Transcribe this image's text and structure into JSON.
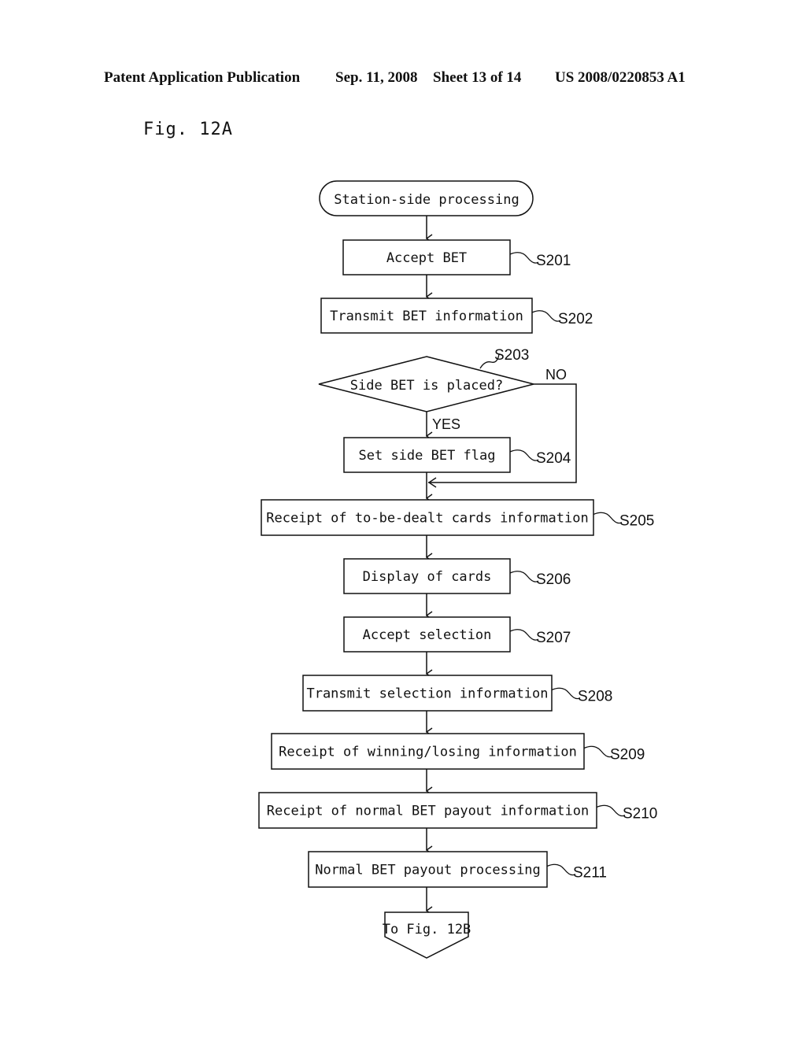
{
  "header": {
    "publication": "Patent Application Publication",
    "date": "Sep. 11, 2008",
    "sheet": "Sheet 13 of 14",
    "patent_number": "US 2008/0220853 A1"
  },
  "figure_label": "Fig. 12A",
  "flowchart": {
    "start": {
      "label": "Station-side processing"
    },
    "steps": [
      {
        "id": "S201",
        "label": "Accept BET",
        "type": "process"
      },
      {
        "id": "S202",
        "label": "Transmit BET information",
        "type": "process"
      },
      {
        "id": "S203",
        "label": "Side BET is placed?",
        "type": "decision",
        "yes_label": "YES",
        "no_label": "NO"
      },
      {
        "id": "S204",
        "label": "Set side BET flag",
        "type": "process"
      },
      {
        "id": "S205",
        "label": "Receipt of to-be-dealt cards information",
        "type": "process"
      },
      {
        "id": "S206",
        "label": "Display of cards",
        "type": "process"
      },
      {
        "id": "S207",
        "label": "Accept selection",
        "type": "process"
      },
      {
        "id": "S208",
        "label": "Transmit selection information",
        "type": "process"
      },
      {
        "id": "S209",
        "label": "Receipt of winning/losing information",
        "type": "process"
      },
      {
        "id": "S210",
        "label": "Receipt of normal BET payout information",
        "type": "process"
      },
      {
        "id": "S211",
        "label": "Normal BET payout processing",
        "type": "process"
      }
    ],
    "connector": {
      "label": "To Fig. 12B"
    }
  }
}
